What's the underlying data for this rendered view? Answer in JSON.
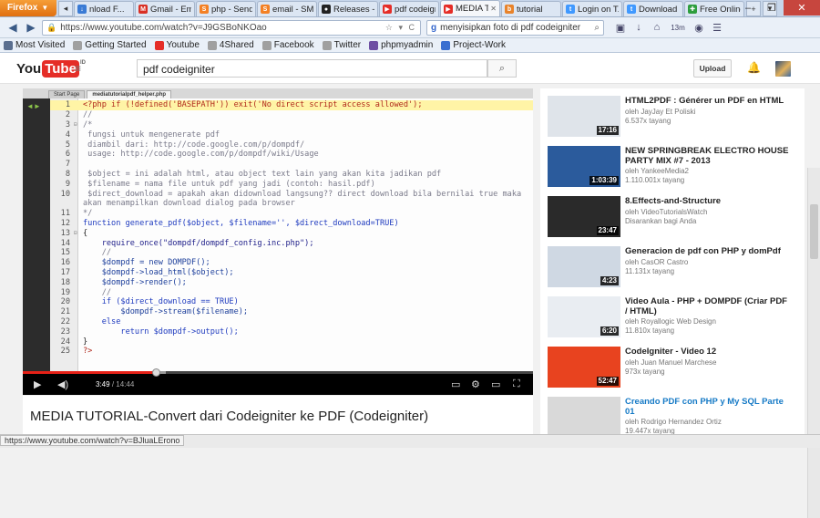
{
  "browser": {
    "menu_button": "Firefox",
    "tabs": [
      {
        "label": "nload F...",
        "fav_color": "#3a7bd5",
        "fav_glyph": "↓"
      },
      {
        "label": "Gmail - Em...",
        "fav_color": "#d93025",
        "fav_glyph": "M"
      },
      {
        "label": "php - Sendi...",
        "fav_color": "#f48024",
        "fav_glyph": "S"
      },
      {
        "label": "email - SMT...",
        "fav_color": "#f48024",
        "fav_glyph": "S"
      },
      {
        "label": "Releases - d...",
        "fav_color": "#222222",
        "fav_glyph": "●"
      },
      {
        "label": "pdf codeign...",
        "fav_color": "#e52d27",
        "fav_glyph": "▶"
      },
      {
        "label": "MEDIA T...",
        "fav_color": "#e52d27",
        "fav_glyph": "▶",
        "active": true
      },
      {
        "label": "tutorial",
        "fav_color": "#e8832b",
        "fav_glyph": "b"
      },
      {
        "label": "Login on T...",
        "fav_color": "#4099ff",
        "fav_glyph": "t"
      },
      {
        "label": "Download t...",
        "fav_color": "#4099ff",
        "fav_glyph": "t"
      },
      {
        "label": "Free Online ...",
        "fav_color": "#2e9e3e",
        "fav_glyph": "✚"
      }
    ],
    "new_tab_glyph": "+",
    "window_controls": {
      "minimize": "–",
      "restore": "❐",
      "close": "✕"
    },
    "url": "https://www.youtube.com/watch?v=J9GSBoNKOao",
    "search_engine_glyph": "g",
    "search_query": "menyisipkan foto di pdf codeigniter",
    "clock": "13m",
    "bookmarks": [
      {
        "label": "Most Visited",
        "icon": "gear-icon",
        "color": "#5b6f8f"
      },
      {
        "label": "Getting Started",
        "icon": "page-icon",
        "color": "#a0a0a0"
      },
      {
        "label": "Youtube",
        "icon": "youtube-icon",
        "color": "#e52d27"
      },
      {
        "label": "4Shared",
        "icon": "page-icon",
        "color": "#a0a0a0"
      },
      {
        "label": "Facebook",
        "icon": "page-icon",
        "color": "#a0a0a0"
      },
      {
        "label": "Twitter",
        "icon": "page-icon",
        "color": "#a0a0a0"
      },
      {
        "label": "phpmyadmin",
        "icon": "db-icon",
        "color": "#6e4fa3"
      },
      {
        "label": "Project-Work",
        "icon": "star-icon",
        "color": "#3a6fd0"
      }
    ],
    "status_url": "https://www.youtube.com/watch?v=BJluaLErono"
  },
  "youtube": {
    "logo_you": "You",
    "logo_tube": "Tube",
    "logo_suffix": "ID",
    "search_value": "pdf codeigniter",
    "upload_label": "Upload",
    "player": {
      "current_time": "3:49",
      "total_time": "14:44",
      "progress": 0.26,
      "buffered": 0.28,
      "editor_tabs": [
        "Start Page",
        "mediatutorialpdf_helper.php"
      ],
      "code_lines": [
        {
          "n": "1",
          "t": "<?php if (!defined('BASEPATH')) exit('No direct script access allowed');"
        },
        {
          "n": "2",
          "t": "//"
        },
        {
          "n": "3",
          "t": "/*"
        },
        {
          "n": "4",
          "t": " fungsi untuk mengenerate pdf"
        },
        {
          "n": "5",
          "t": " diambil dari: http://code.google.com/p/dompdf/"
        },
        {
          "n": "6",
          "t": " usage: http://code.google.com/p/dompdf/wiki/Usage"
        },
        {
          "n": "7",
          "t": ""
        },
        {
          "n": "8",
          "t": " $object = ini adalah html, atau object text lain yang akan kita jadikan pdf"
        },
        {
          "n": "9",
          "t": " $filename = nama file untuk pdf yang jadi (contoh: hasil.pdf)"
        },
        {
          "n": "10",
          "t": " $direct_download = apakah akan didownload langsung?? direct download bila bernilai true maka"
        },
        {
          "n": "",
          "t": "akan menampilkan download dialog pada browser"
        },
        {
          "n": "11",
          "t": "*/"
        },
        {
          "n": "12",
          "t": "function generate_pdf($object, $filename='', $direct_download=TRUE)"
        },
        {
          "n": "13",
          "t": "{"
        },
        {
          "n": "14",
          "t": "    require_once(\"dompdf/dompdf_config.inc.php\");"
        },
        {
          "n": "15",
          "t": "    //"
        },
        {
          "n": "16",
          "t": "    $dompdf = new DOMPDF();"
        },
        {
          "n": "17",
          "t": "    $dompdf->load_html($object);"
        },
        {
          "n": "18",
          "t": "    $dompdf->render();"
        },
        {
          "n": "19",
          "t": "    //"
        },
        {
          "n": "20",
          "t": "    if ($direct_download == TRUE)"
        },
        {
          "n": "21",
          "t": "        $dompdf->stream($filename);"
        },
        {
          "n": "22",
          "t": "    else"
        },
        {
          "n": "23",
          "t": "        return $dompdf->output();"
        },
        {
          "n": "24",
          "t": "}"
        },
        {
          "n": "25",
          "t": "?>"
        }
      ]
    },
    "video_title": "MEDIA TUTORIAL-Convert dari Codeigniter ke PDF (Codeigniter)",
    "related": [
      {
        "title": "HTML2PDF : Générer un PDF en HTML",
        "by": "oleh JayJay Et Poliski",
        "views": "6.537x tayang",
        "duration": "17:16",
        "thumb": "#dfe4ea",
        "link": false
      },
      {
        "title": "NEW SPRINGBREAK ELECTRO HOUSE PARTY MIX #7 - 2013",
        "by": "oleh YankeeMedia2",
        "views": "1.110.001x tayang",
        "duration": "1:03:39",
        "thumb": "#2b5b9c",
        "link": false
      },
      {
        "title": "8.Effects-and-Structure",
        "by": "oleh VideoTutorialsWatch",
        "views": "Disarankan bagi Anda",
        "duration": "23:47",
        "thumb": "#2a2a2a",
        "link": false
      },
      {
        "title": "Generacion de pdf con PHP y domPdf",
        "by": "oleh CasOR Castro",
        "views": "11.131x tayang",
        "duration": "4:23",
        "thumb": "#cfd8e3",
        "link": false
      },
      {
        "title": "Video Aula - PHP + DOMPDF (Criar PDF / HTML)",
        "by": "oleh Royallogic Web Design",
        "views": "11.810x tayang",
        "duration": "6:20",
        "thumb": "#e9edf2",
        "link": false
      },
      {
        "title": "CodeIgniter - Video 12",
        "by": "oleh Juan Manuel Marchese",
        "views": "973x tayang",
        "duration": "52:47",
        "thumb": "#e8431f",
        "link": false
      },
      {
        "title": "Creando PDF con PHP y My SQL Parte 01",
        "by": "oleh Rodrigo Hernandez Ortiz",
        "views": "19.447x tayang",
        "duration": "",
        "thumb": "#d9d9d9",
        "link": true
      }
    ]
  }
}
